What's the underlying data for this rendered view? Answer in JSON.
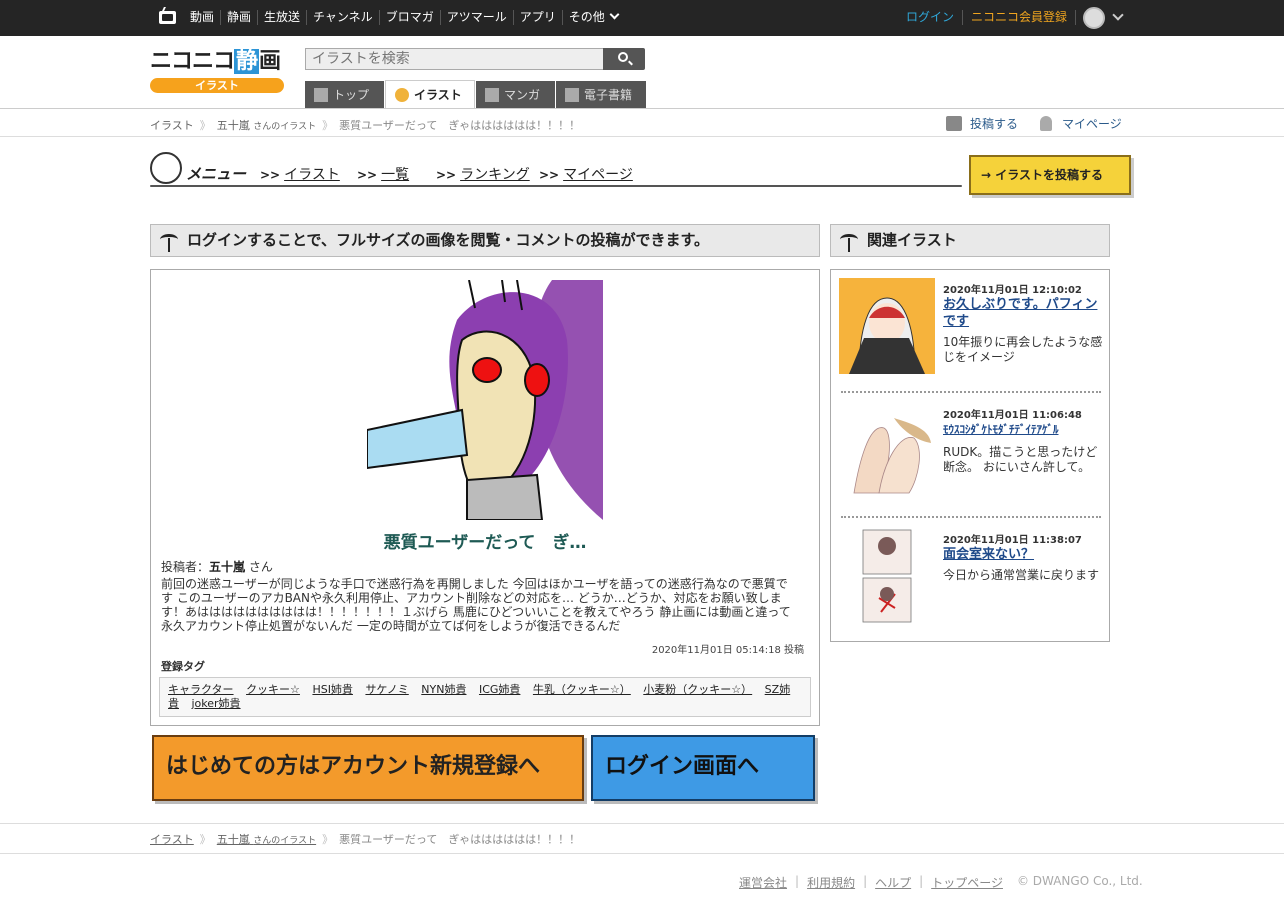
{
  "topbar": {
    "nav": [
      "動画",
      "静画",
      "生放送",
      "チャンネル",
      "ブロマガ",
      "アツマール",
      "アプリ",
      "その他"
    ],
    "login": "ログイン",
    "register": "ニコニコ会員登録"
  },
  "header": {
    "logo_main": "ニコニコ",
    "logo_accent": "静",
    "logo_tail": "画",
    "logo_sub": "イラスト",
    "search_placeholder": "イラストを検索",
    "tabs": [
      "トップ",
      "イラスト",
      "マンガ",
      "電子書籍"
    ]
  },
  "breadcrumb": {
    "home": "イラスト",
    "user": "五十嵐",
    "user_suffix": "さんのイラスト",
    "current": "悪質ユーザーだって　ぎゃはははははは！！！！"
  },
  "crumb_actions": {
    "post": "投稿する",
    "mypage": "マイページ"
  },
  "menu": {
    "label": "メニュー",
    "items": [
      "イラスト",
      "一覧",
      "ランキング",
      "マイページ"
    ],
    "arrow": ">>",
    "post_button": "→ イラストを投稿する"
  },
  "notice": "ログインすることで、フルサイズの画像を閲覧・コメントの投稿ができます。",
  "work": {
    "title": "悪質ユーザーだって　ぎ…",
    "poster_label": "投稿者：",
    "poster_name": "五十嵐",
    "poster_suffix": "さん",
    "description": "前回の迷惑ユーザーが同じような手口で迷惑行為を再開しました 今回はほかユーザを語っての迷惑行為なので悪質です このユーザーのアカBANや永久利用停止、アカウント削除などの対応を… どうか…どうか、対応をお願い致します！あはははははははははは！！！！！！！１ぶげら 馬鹿にひどついいことを教えてやろう 静止画には動画と違って永久アカウント停止処置がないんだ 一定の時間が立てば何をしようが復活できるんだ",
    "posted_at": "2020年11月01日 05:14:18 投稿",
    "tags_label": "登録タグ",
    "tags": [
      "キャラクター",
      "クッキー☆",
      "HSI姉貴",
      "サケノミ",
      "NYN姉貴",
      "ICG姉貴",
      "牛乳（クッキー☆）",
      "小麦粉（クッキー☆）",
      "SZ姉貴",
      "joker姉貴"
    ]
  },
  "banners": {
    "register": "はじめての方はアカウント新規登録へ",
    "login": "ログイン画面へ"
  },
  "related": {
    "heading": "関連イラスト",
    "items": [
      {
        "date": "2020年11月01日 12:10:02",
        "title": "お久しぶりです。パフィンです",
        "desc": "10年振りに再会したような感じをイメージ"
      },
      {
        "date": "2020年11月01日 11:06:48",
        "title": "ﾓｳｽｺｼﾀﾞｹﾄﾓﾀﾞﾁﾃﾞｲﾃｱｹﾞﾙ",
        "desc": "RUDK。描こうと思ったけど断念。 おにいさん許して。"
      },
      {
        "date": "2020年11月01日 11:38:07",
        "title": "面会室来ない？",
        "desc": "今日から通常営業に戻ります"
      }
    ]
  },
  "footer": {
    "links": [
      "運営会社",
      "利用規約",
      "ヘルプ",
      "トップページ"
    ],
    "copyright": "© DWANGO Co., Ltd."
  }
}
